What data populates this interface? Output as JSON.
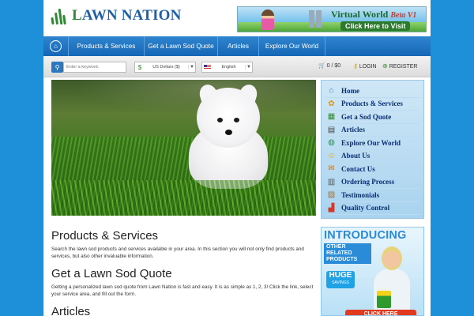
{
  "brand": {
    "logo_text_l": "L",
    "logo_text_rest": "AWN NATION",
    "logo_color": "#1f5fa6",
    "accent": "#2f8a34"
  },
  "header_banner": {
    "title": "Virtual World",
    "badge": "Beta V1",
    "link_label": "Click Here to Visit"
  },
  "nav": {
    "home_icon": "home-icon",
    "items": [
      {
        "label": "Products & Services"
      },
      {
        "label": "Get a Lawn Sod Quote"
      },
      {
        "label": "Articles"
      },
      {
        "label": "Explore Our World"
      }
    ]
  },
  "toolbar": {
    "search_placeholder": "Enter a keyword.",
    "currency": "US Dollars ($)",
    "language": "English",
    "cart": "0 / $0",
    "login": "LOGIN",
    "register": "REGISTER"
  },
  "sidebar": {
    "items": [
      {
        "label": "Home",
        "icon": "house-icon",
        "glyph": "⌂",
        "color": "#3a7ac8"
      },
      {
        "label": "Products & Services",
        "icon": "products-icon",
        "glyph": "✿",
        "color": "#d49a1a"
      },
      {
        "label": "Get a Sod Quote",
        "icon": "quote-icon",
        "glyph": "▦",
        "color": "#2e8b2e"
      },
      {
        "label": "Articles",
        "icon": "book-icon",
        "glyph": "▤",
        "color": "#444444"
      },
      {
        "label": "Explore Our World",
        "icon": "globe-icon",
        "glyph": "◍",
        "color": "#2a8a5a"
      },
      {
        "label": "About Us",
        "icon": "smiley-icon",
        "glyph": "☺",
        "color": "#e0a010"
      },
      {
        "label": "Contact Us",
        "icon": "envelope-icon",
        "glyph": "✉",
        "color": "#c07a20"
      },
      {
        "label": "Ordering Process",
        "icon": "clipboard-icon",
        "glyph": "▥",
        "color": "#555555"
      },
      {
        "label": "Testimonials",
        "icon": "document-icon",
        "glyph": "▧",
        "color": "#a07030"
      },
      {
        "label": "Quality Control",
        "icon": "bar-chart-icon",
        "glyph": "▟",
        "color": "#d03a2a"
      }
    ]
  },
  "content": {
    "sections": [
      {
        "title": "Products & Services",
        "text": "Search the lawn sod products and services available in your area. In this section you will not only find products and services, but also other invaluable information."
      },
      {
        "title": "Get a Lawn Sod Quote",
        "text": "Getting a personalized lawn sod quote from Lawn Nation is fast and easy. It is as simple as 1, 2, 3! Click the link, select your service area, and fill out the form."
      },
      {
        "title": "Articles",
        "text": ""
      }
    ]
  },
  "promo": {
    "heading": "INTRODUCING",
    "subheading": "OTHER RELATED PRODUCTS",
    "huge": "HUGE",
    "savings": "SAVINGS",
    "cta": "CLICK HERE"
  }
}
